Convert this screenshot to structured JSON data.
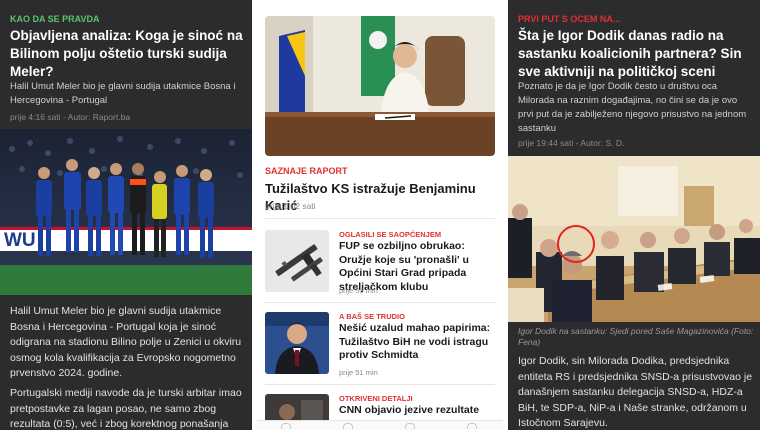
{
  "panel1": {
    "kicker": "KAO DA SE PRAVDA",
    "kicker_color": "#5cc46a",
    "headline": "Objavljena analiza: Koga je sinoć na Bilinom polju oštetio turski sudija Meler?",
    "lead": "Halil Umut Meler bio je glavni sudija utakmice Bosna i Hercegovina - Portugal",
    "time": "prije 4:16 sati",
    "author": "Autor: Raport.ba",
    "photo_banner_text": "WU",
    "body_p1": "Halil Umut Meler bio je glavni sudija utakmice Bosna i Hercegovina - Portugal koja je sinoć odigrana na stadionu Bilino polje u Zenici u okviru osmog kola kvalifikacija za Evropsko nogometno prvenstvo 2024. godine.",
    "body_p2": "Portugalski mediji navode da je turski arbitar imao pretpostavke za lagan posao, ne samo zbog rezultata (0:5), već i zbog korektnog ponašanja"
  },
  "panel2": {
    "lead_story": {
      "kicker": "SAZNAJE RAPORT",
      "headline": "Tužilaštvo KS istražuje Benjaminu Karić",
      "time": "prije 1:02 sati"
    },
    "items": [
      {
        "kicker": "OGLASILI SE SAOPĆENJEM",
        "headline": "FUP se ozbiljno obrukao: Oružje koje su 'pronašli' u Općini Stari Grad pripada streljačkom klubu",
        "time": "prije 55 min"
      },
      {
        "kicker": "A BAŠ SE TRUDIO",
        "headline": "Nešić uzalud mahao papirima: Tužilaštvo BiH ne vodi istragu protiv Schmidta",
        "time": "prije 51 min"
      },
      {
        "kicker": "OTKRIVENI DETALJI",
        "headline": "CNN objavio jezive rezultate",
        "time": ""
      }
    ],
    "nav_icons": [
      "home-icon",
      "search-icon",
      "bookmark-icon",
      "menu-icon"
    ]
  },
  "panel3": {
    "kicker": "PRVI PUT S OCEM NA...",
    "kicker_color": "#e03131",
    "headline": "Šta je Igor Dodik danas radio na sastanku koalicionih partnera? Sin sve aktivniji na političkoj sceni",
    "lead": "Poznato je da je Igor Dodik često u društvu oca Milorada na raznim događajima, no čini se da je ovo prvi put da je zabilježeno njegovo prisustvo na jednom sastanku",
    "time": "prije 19:44 sati",
    "author": "Autor: S. D.",
    "caption": "Igor Dodik na sastanku: Sjedi pored Saše Magazinovića (Foto: Fena)",
    "body": "Igor Dodik, sin Milorada Dodika, predsjednika entiteta RS i predsjednika SNSD-a prisustvovao je današnjem sastanku delegacija SNSD-a, HDZ-a BiH, te SDP-a, NiP-a i Naše stranke, održanom u Istočnom Sarajevu."
  }
}
